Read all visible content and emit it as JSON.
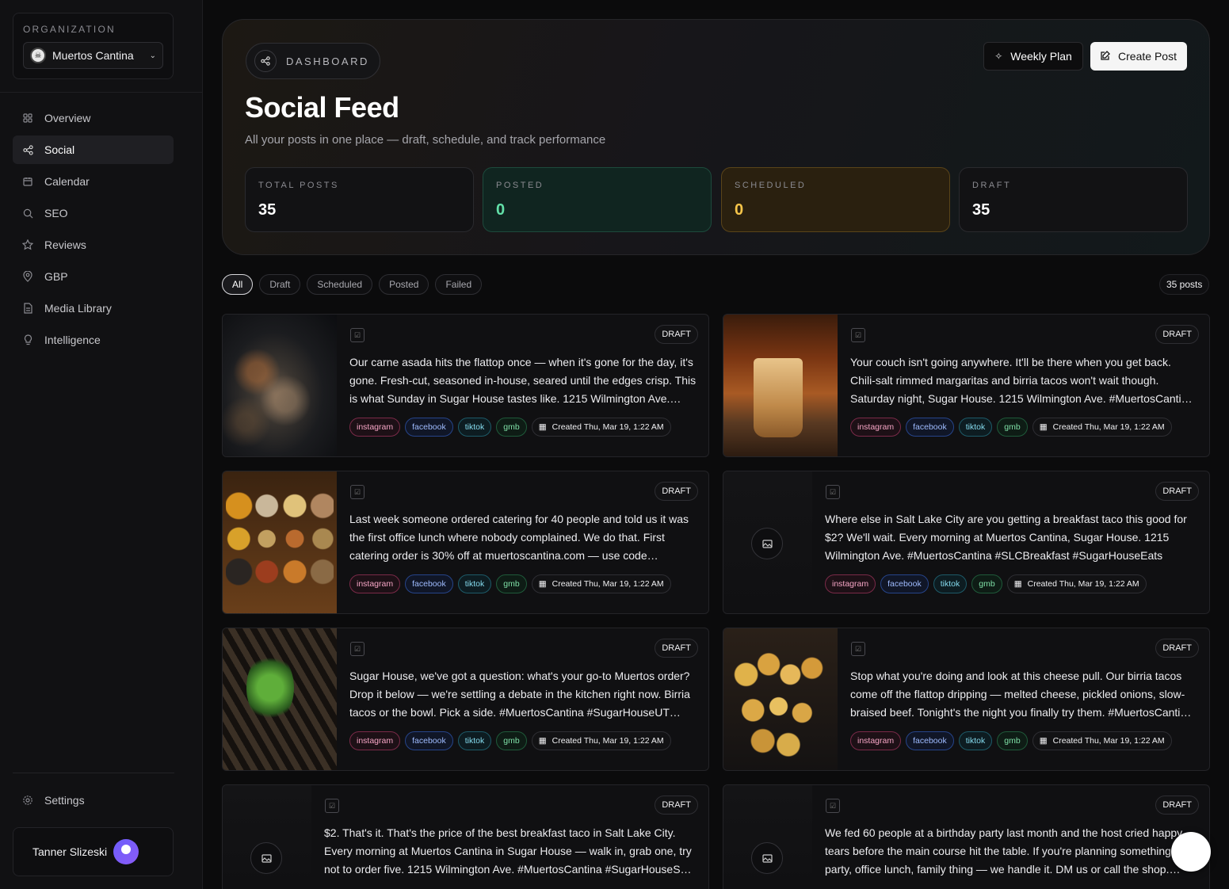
{
  "sidebar": {
    "org_label": "ORGANIZATION",
    "org_name": "Muertos Cantina",
    "nav": [
      {
        "label": "Overview",
        "icon": "grid-icon"
      },
      {
        "label": "Social",
        "icon": "share-icon"
      },
      {
        "label": "Calendar",
        "icon": "calendar-icon"
      },
      {
        "label": "SEO",
        "icon": "search-icon"
      },
      {
        "label": "Reviews",
        "icon": "star-icon"
      },
      {
        "label": "GBP",
        "icon": "map-pin-icon"
      },
      {
        "label": "Media Library",
        "icon": "file-icon"
      },
      {
        "label": "Intelligence",
        "icon": "lightbulb-icon"
      }
    ],
    "active": "Social",
    "settings_label": "Settings",
    "user_name": "Tanner Slizeski"
  },
  "header": {
    "section_label": "DASHBOARD",
    "title": "Social Feed",
    "subtitle": "All your posts in one place — draft, schedule, and track performance",
    "weekly_plan_label": "Weekly Plan",
    "create_post_label": "Create Post"
  },
  "stats": {
    "total": {
      "label": "TOTAL POSTS",
      "value": "35"
    },
    "posted": {
      "label": "POSTED",
      "value": "0",
      "color": "#62e0a8"
    },
    "scheduled": {
      "label": "SCHEDULED",
      "value": "0",
      "color": "#f6c54a"
    },
    "draft": {
      "label": "DRAFT",
      "value": "35"
    }
  },
  "filters": [
    "All",
    "Draft",
    "Scheduled",
    "Posted",
    "Failed"
  ],
  "active_filter": "All",
  "post_count": "35 posts",
  "platform_tags": [
    "instagram",
    "facebook",
    "tiktok",
    "gmb"
  ],
  "posts": [
    {
      "status": "DRAFT",
      "created": "Created Thu, Mar 19, 1:22 AM",
      "text": "Our carne asada hits the flattop once — when it's gone for the day, it's gone. Fresh-cut, seasoned in-house, seared until the edges crisp. This is what Sunday in Sugar House tastes like. 1215 Wilmington Ave.…"
    },
    {
      "status": "DRAFT",
      "created": "Created Thu, Mar 19, 1:22 AM",
      "text": "Your couch isn't going anywhere. It'll be there when you get back. Chili-salt rimmed margaritas and birria tacos won't wait though. Saturday night, Sugar House. 1215 Wilmington Ave. #MuertosCanti…"
    },
    {
      "status": "DRAFT",
      "created": "Created Thu, Mar 19, 1:22 AM",
      "text": "Last week someone ordered catering for 40 people and told us it was the first office lunch where nobody complained. We do that. First catering order is 30% off at muertoscantina.com — use code…"
    },
    {
      "status": "DRAFT",
      "created": "Created Thu, Mar 19, 1:22 AM",
      "text": "Where else in Salt Lake City are you getting a breakfast taco this good for $2? We'll wait. Every morning at Muertos Cantina, Sugar House. 1215 Wilmington Ave. #MuertosCantina #SLCBreakfast #SugarHouseEats"
    },
    {
      "status": "DRAFT",
      "created": "Created Thu, Mar 19, 1:22 AM",
      "text": "Sugar House, we've got a question: what's your go-to Muertos order? Drop it below — we're settling a debate in the kitchen right now. Birria tacos or the bowl. Pick a side. #MuertosCantina #SugarHouseUT…"
    },
    {
      "status": "DRAFT",
      "created": "Created Thu, Mar 19, 1:22 AM",
      "text": "Stop what you're doing and look at this cheese pull. Our birria tacos come off the flattop dripping — melted cheese, pickled onions, slow-braised beef. Tonight's the night you finally try them. #MuertosCanti…"
    },
    {
      "status": "DRAFT",
      "created": "",
      "text": "$2. That's it. That's the price of the best breakfast taco in Salt Lake City. Every morning at Muertos Cantina in Sugar House — walk in, grab one, try not to order five. 1215 Wilmington Ave. #MuertosCantina #SugarHouseS…"
    },
    {
      "status": "DRAFT",
      "created": "",
      "text": "We fed 60 people at a birthday party last month and the host cried happy tears before the main course hit the table. If you're planning something — party, office lunch, family thing — we handle it. DM us or call the shop.…"
    }
  ]
}
